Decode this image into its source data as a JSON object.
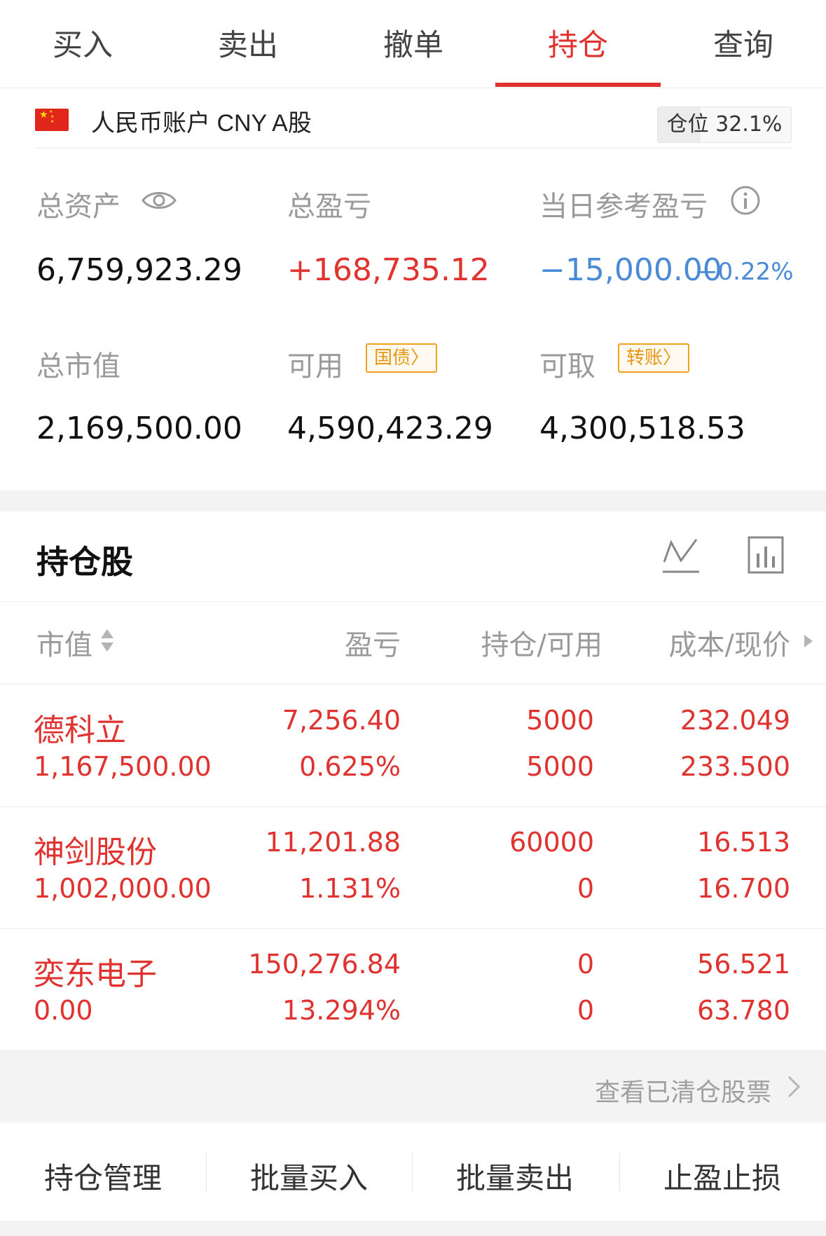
{
  "tabs": [
    {
      "label": "买入"
    },
    {
      "label": "卖出"
    },
    {
      "label": "撤单"
    },
    {
      "label": "持仓"
    },
    {
      "label": "查询"
    }
  ],
  "account": {
    "name": "人民币账户 CNY A股",
    "position_label": "仓位 32.1%",
    "position_fraction": 0.321
  },
  "summary": {
    "total_assets_label": "总资产",
    "total_assets": "6,759,923.29",
    "total_pnl_label": "总盈亏",
    "total_pnl": "+168,735.12",
    "daily_pnl_label": "当日参考盈亏",
    "daily_pnl": "−15,000.00",
    "daily_pnl_pct": "−0.22%",
    "market_value_label": "总市值",
    "market_value": "2,169,500.00",
    "available_label": "可用",
    "available_pill": "国债",
    "available": "4,590,423.29",
    "withdrawable_label": "可取",
    "withdrawable_pill": "转账",
    "withdrawable": "4,300,518.53"
  },
  "holdings": {
    "title": "持仓股",
    "columns": [
      "市值",
      "盈亏",
      "持仓/可用",
      "成本/现价"
    ],
    "rows": [
      {
        "name": "德科立",
        "market_value": "1,167,500.00",
        "pnl": "7,256.40",
        "pnl_pct": "0.625%",
        "position": "5000",
        "available": "5000",
        "cost": "232.049",
        "price": "233.500"
      },
      {
        "name": "神剑股份",
        "market_value": "1,002,000.00",
        "pnl": "11,201.88",
        "pnl_pct": "1.131%",
        "position": "60000",
        "available": "0",
        "cost": "16.513",
        "price": "16.700"
      },
      {
        "name": "奕东电子",
        "market_value": "0.00",
        "pnl": "150,276.84",
        "pnl_pct": "13.294%",
        "position": "0",
        "available": "0",
        "cost": "56.521",
        "price": "63.780"
      }
    ],
    "cleared_link": "查看已清仓股票"
  },
  "bottom_actions": [
    {
      "label": "持仓管理"
    },
    {
      "label": "批量买入"
    },
    {
      "label": "批量卖出"
    },
    {
      "label": "止盈止损"
    }
  ],
  "colors": {
    "accent": "#e0322f",
    "down": "#4a8ad6",
    "pill": "#e89511"
  },
  "icons": [
    "eye-icon",
    "info-icon",
    "trend-chart-icon",
    "bar-chart-icon",
    "sort-icon",
    "caret-right-icon",
    "chevron-right-icon",
    "cn-flag-icon"
  ]
}
